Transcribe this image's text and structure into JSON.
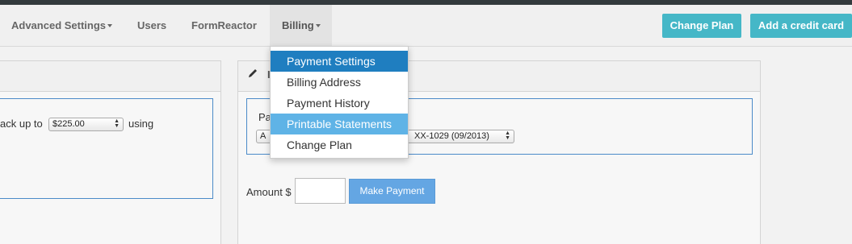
{
  "nav": {
    "items": [
      {
        "label": "Advanced Settings",
        "has_caret": true
      },
      {
        "label": "Users",
        "has_caret": false
      },
      {
        "label": "FormReactor",
        "has_caret": false
      },
      {
        "label": "Billing",
        "has_caret": true
      }
    ],
    "buttons": {
      "change_plan": "Change Plan",
      "add_credit_card": "Add a credit card"
    }
  },
  "billing_menu": {
    "items": [
      {
        "label": "Payment Settings",
        "state": "active"
      },
      {
        "label": "Billing Address",
        "state": "normal"
      },
      {
        "label": "Payment History",
        "state": "normal"
      },
      {
        "label": "Printable Statements",
        "state": "hover"
      },
      {
        "label": "Change Plan",
        "state": "normal"
      }
    ]
  },
  "left_panel": {
    "text_prefix": "ack up to",
    "amount_select": "$225.00",
    "text_suffix": "using"
  },
  "right_panel": {
    "header_icon": "pencil-icon",
    "header_title_partial": "I",
    "field_label_partial": "Pa",
    "card_select_prefix": "A",
    "card_select_value": "XX-1029 (09/2013)",
    "amount_label": "Amount $",
    "amount_value": "",
    "make_payment_label": "Make Payment"
  },
  "colors": {
    "top_strip": "#333a3d",
    "nav_button": "#45b7c7",
    "menu_active": "#1f7ec0",
    "menu_hover": "#5fb3e6",
    "primary_button": "#64a6e3",
    "focus_border": "#4b8ac8"
  }
}
